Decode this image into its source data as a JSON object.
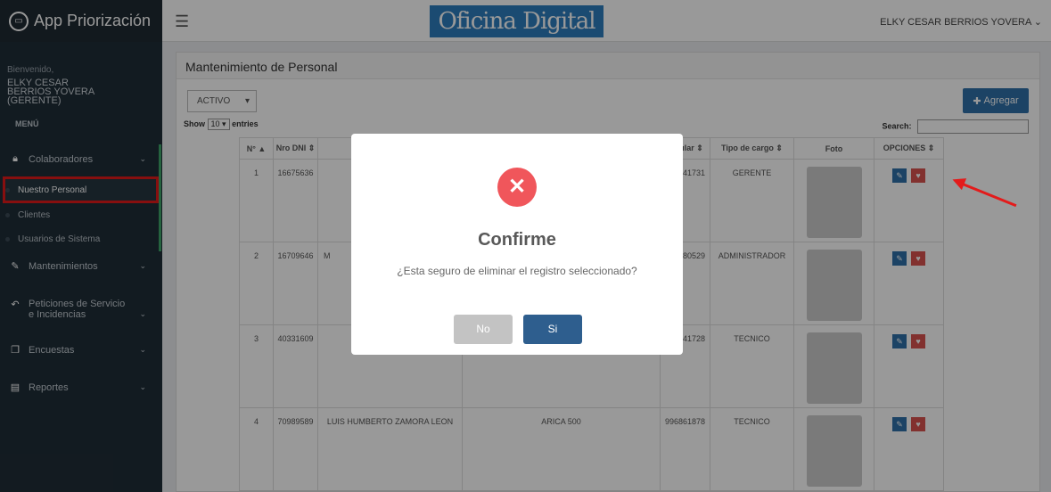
{
  "app": {
    "title": "App Priorización"
  },
  "sidebar": {
    "welcome_label": "Bienvenido,",
    "user_name": "ELKY CESAR BERRIOS YOVERA (GERENTE)",
    "menu_header": "MENÚ",
    "items": [
      {
        "label": "Colaboradores",
        "icon": "lock-icon"
      },
      {
        "label": "Mantenimientos",
        "icon": "edit-icon"
      },
      {
        "label": "Peticiones de Servicio e Incidencias",
        "icon": "reply-icon"
      },
      {
        "label": "Encuestas",
        "icon": "copy-icon"
      },
      {
        "label": "Reportes",
        "icon": "file-icon"
      }
    ],
    "subitems": [
      {
        "label": "Nuestro Personal"
      },
      {
        "label": "Clientes"
      },
      {
        "label": "Usuarios de Sistema"
      }
    ]
  },
  "topbar": {
    "logo_text": "Oficina Digital",
    "user_name": "ELKY CESAR BERRIOS YOVERA"
  },
  "panel": {
    "title": "Mantenimiento de Personal",
    "status_select": "ACTIVO",
    "add_button": "Agregar",
    "show_label": "Show",
    "entries_value": "10",
    "entries_label": "entries",
    "search_label": "Search:"
  },
  "table": {
    "headers": [
      "N°",
      "Nro DNI",
      "",
      "",
      "Celular",
      "Tipo de cargo",
      "Foto",
      "OPCIONES"
    ],
    "rows": [
      {
        "num": "1",
        "dni": "16675636",
        "name": "",
        "address": "",
        "celular": "979541731",
        "cargo": "GERENTE"
      },
      {
        "num": "2",
        "dni": "16709646",
        "name": "M",
        "address": "",
        "celular": "927980529",
        "cargo": "ADMINISTRADOR"
      },
      {
        "num": "3",
        "dni": "40331609",
        "name": "",
        "address": "",
        "celular": "979541728",
        "cargo": "TECNICO"
      },
      {
        "num": "4",
        "dni": "70989589",
        "name": "LUIS HUMBERTO ZAMORA LEON",
        "address": "ARICA 500",
        "celular": "996861878",
        "cargo": "TECNICO"
      }
    ]
  },
  "modal": {
    "title": "Confirme",
    "text": "¿Esta seguro de eliminar el registro seleccionado?",
    "no_label": "No",
    "yes_label": "Si",
    "icon": "x-icon"
  },
  "colors": {
    "sidebar": "#1f2d37",
    "primary": "#3071a9",
    "danger": "#d9534f",
    "modal_x": "#f0565b",
    "highlight": "#e21a1a",
    "yes_button": "#2e5e8e",
    "no_button": "#c3c3c3"
  }
}
